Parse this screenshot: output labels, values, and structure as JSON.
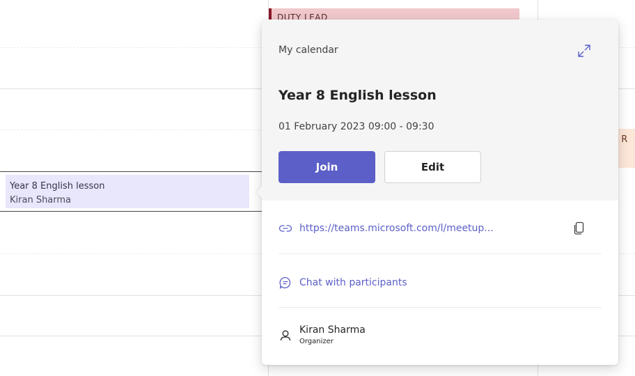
{
  "background_events": {
    "duty": "DUTY LEAD",
    "side": "lk R"
  },
  "calendar_event": {
    "title": "Year 8 English lesson",
    "organizer": "Kiran Sharma"
  },
  "popup": {
    "calendar_name": "My calendar",
    "title": "Year 8 English lesson",
    "datetime": "01 February 2023 09:00 - 09:30",
    "join_label": "Join",
    "edit_label": "Edit",
    "meeting_link": "https://teams.microsoft.com/l/meetup...",
    "chat_label": "Chat with participants",
    "organizer_name": "Kiran Sharma",
    "organizer_role": "Organizer",
    "accent_color": "#5b5fc7",
    "icons": [
      "expand-icon",
      "link-icon",
      "copy-icon",
      "chat-icon",
      "person-icon"
    ]
  }
}
